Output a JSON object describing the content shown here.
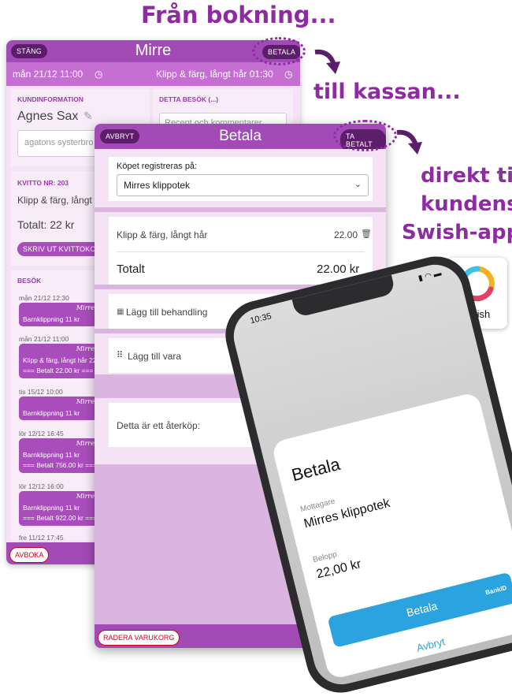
{
  "captions": {
    "from_booking": "Från bokning...",
    "to_checkout": "till kassan...",
    "direct_line1": "direkt till",
    "direct_line2": "kundens",
    "direct_line3": "Swish-app"
  },
  "booking": {
    "close_label": "STÄNG",
    "title": "Mirre",
    "pay_label": "BETALA",
    "date_time": "mån 21/12 11:00",
    "service_duration": "Klipp & färg, långt hår 01:30",
    "customer_info_label": "KUNDINFORMATION",
    "customer_name": "Agnes Sax",
    "customer_note": "agatons systerbro",
    "this_visit_label": "DETTA BESÖK (...)",
    "visit_notes_placeholder": "Recept och kommentarer",
    "receipt_label": "KVITTO NR: 203",
    "receipt_service": "Klipp & färg, långt hår",
    "receipt_total": "Totalt: 22 kr",
    "print_receipt_label": "SKRIV UT KVITTOKOPIA",
    "visits_label": "BESÖK",
    "visits": [
      {
        "date": "mån 21/12 12:30",
        "staff": "Mirre",
        "line1": "Barnklippning 11 kr",
        "line2": ""
      },
      {
        "date": "mån 21/12 11:00",
        "staff": "Mirre",
        "line1": "Klipp & färg, långt hår 22",
        "line2": "=== Betalt 22.00 kr ==="
      },
      {
        "date": "tis 15/12 10:00",
        "staff": "Mirre",
        "line1": "Barnklippning 11 kr",
        "line2": ""
      },
      {
        "date": "lör 12/12 16:45",
        "staff": "Mirre",
        "line1": "Barnklippning 11 kr",
        "line2": "=== Betalt 756.00 kr ==="
      },
      {
        "date": "lör 12/12 16:00",
        "staff": "Mirre",
        "line1": "Barnklippning 11 kr",
        "line2": "=== Betalt 922.00 kr ==="
      }
    ],
    "last_visit_date": "fre 11/12 17:45",
    "unbook_label": "AVBOKA"
  },
  "checkout": {
    "cancel_label": "AVBRYT",
    "title": "Betala",
    "paid_label": "TA BETALT",
    "register_on_label": "Köpet registreras på:",
    "register_on_value": "Mirres klippotek",
    "item_name": "Klipp & färg, långt hår",
    "item_price": "22.00",
    "total_label": "Totalt",
    "total_value": "22.00 kr",
    "add_treatment": "Lägg till behandling",
    "add_product": "Lägg till vara",
    "return_purchase": "Detta är ett återköp:",
    "clear_cart_label": "RADERA VARUKORG"
  },
  "swish_logo_text": "swish",
  "phone": {
    "time": "10:35",
    "sheet_title": "Betala",
    "recipient_label": "Mottagare",
    "recipient": "Mirres klippotek",
    "amount_label": "Belopp",
    "amount": "22,00 kr",
    "pay_button": "Betala",
    "cancel": "Avbryt",
    "bankid_text": "BankID"
  },
  "colors": {
    "accent": "#8e2ba3",
    "header": "#a24ab5",
    "swish_blue": "#2aa3de"
  }
}
